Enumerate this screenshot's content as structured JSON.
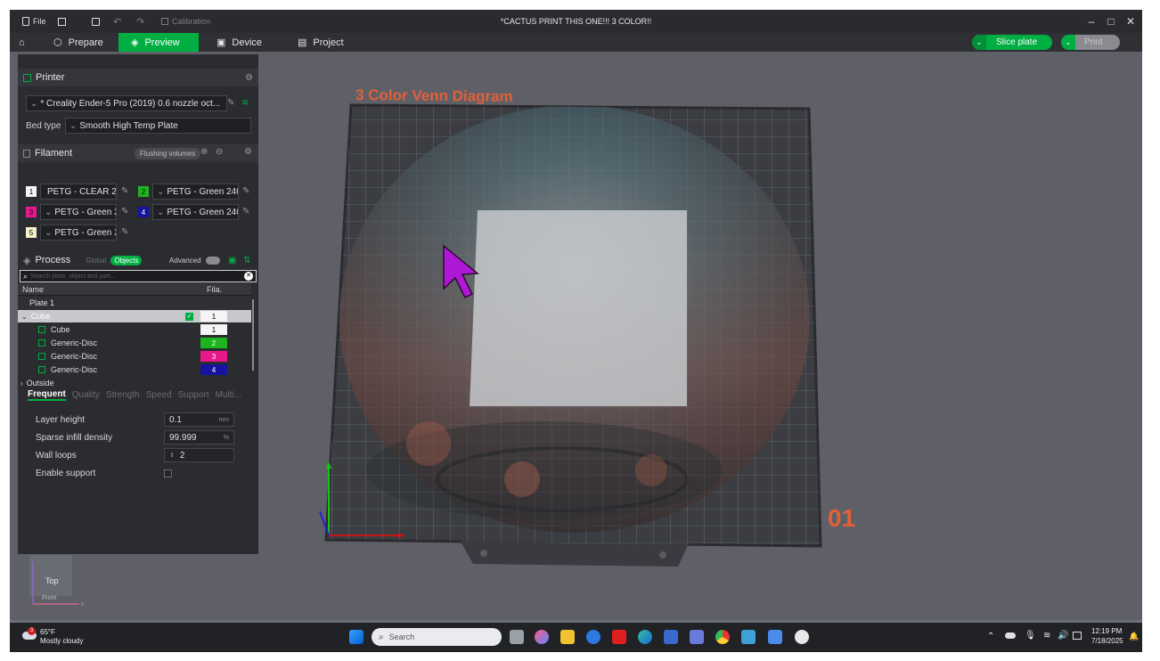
{
  "window": {
    "title": "*CACTUS PRINT THIS ONE!!! 3 COLOR!!",
    "file_label": "File",
    "calibration_label": "Calibration"
  },
  "tabs": [
    {
      "label": "Prepare"
    },
    {
      "label": "Preview"
    },
    {
      "label": "Device"
    },
    {
      "label": "Project"
    }
  ],
  "actions": {
    "slice_label": "Slice plate",
    "print_label": "Print"
  },
  "printer": {
    "header": "Printer",
    "name": "* Creality Ender-5 Pro (2019) 0.6 nozzle oct...",
    "bed_type_label": "Bed type",
    "bed_type": "Smooth High Temp Plate"
  },
  "filament": {
    "header": "Filament",
    "flushing_label": "Flushing volumes",
    "slots": [
      {
        "num": "1",
        "name": "PETG - CLEAR 2...",
        "color": "#f5f5f5"
      },
      {
        "num": "2",
        "name": "PETG - Green 240-...",
        "color": "#1db51d"
      },
      {
        "num": "3",
        "name": "PETG - Green 24...",
        "color": "#e8188c"
      },
      {
        "num": "4",
        "name": "PETG - Green 240-...",
        "color": "#1414a0"
      },
      {
        "num": "5",
        "name": "PETG - Green 24...",
        "color": "#f6f0c8"
      }
    ]
  },
  "process": {
    "header": "Process",
    "global_label": "Global",
    "objects_label": "Objects",
    "advanced_label": "Advanced",
    "search_placeholder": "Search plate, object and part...",
    "col_name": "Name",
    "col_fila": "Fila.",
    "rows": [
      {
        "label": "Plate 1",
        "fila": ""
      },
      {
        "label": "Cube",
        "fila": "1"
      },
      {
        "label": "Cube",
        "fila": "1"
      },
      {
        "label": "Generic-Disc",
        "fila": "2"
      },
      {
        "label": "Generic-Disc",
        "fila": "3"
      },
      {
        "label": "Generic-Disc",
        "fila": "4"
      },
      {
        "label": "Outside",
        "fila": ""
      }
    ],
    "subtabs": [
      "Frequent",
      "Quality",
      "Strength",
      "Speed",
      "Support",
      "Multi..."
    ],
    "params": [
      {
        "label": "Layer height",
        "value": "0.1",
        "unit": "mm"
      },
      {
        "label": "Sparse infill density",
        "value": "99.999",
        "unit": "%"
      },
      {
        "label": "Wall loops",
        "value": "2",
        "unit": ""
      },
      {
        "label": "Enable support",
        "value": "",
        "unit": ""
      }
    ]
  },
  "viewport": {
    "plate_title": "3 Color Venn Diagram",
    "plate_number": "01",
    "view_top": "Top",
    "view_front": "Front"
  },
  "taskbar": {
    "weather_temp": "65°F",
    "weather_desc": "Mostly cloudy",
    "weather_badge": "3",
    "search_label": "Search",
    "time": "12:19 PM",
    "date": "7/18/2025"
  }
}
